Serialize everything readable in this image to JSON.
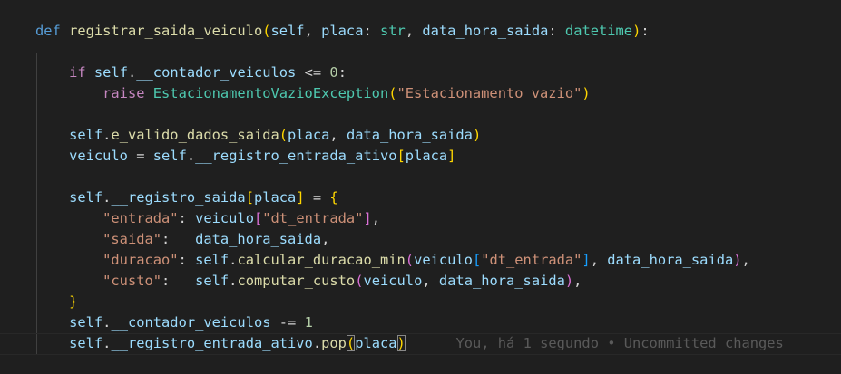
{
  "editor": {
    "language": "python",
    "colors": {
      "background": "#1f1f1f",
      "keyword_blue": "#569cd6",
      "keyword_purple": "#c586c0",
      "function": "#dcdcaa",
      "variable": "#9cdcfe",
      "type": "#4ec9b0",
      "string": "#ce9178",
      "number": "#b5cea8"
    },
    "blame_annotation": "You, há 1 segundo • Uncommitted changes",
    "lines": [
      [
        {
          "t": "def",
          "c": "kw"
        },
        {
          "t": " ",
          "c": "sp"
        },
        {
          "t": "registrar_saida_veiculo",
          "c": "fn"
        },
        {
          "t": "(",
          "c": "b1"
        },
        {
          "t": "self",
          "c": "pm"
        },
        {
          "t": ", ",
          "c": "op"
        },
        {
          "t": "placa",
          "c": "pm"
        },
        {
          "t": ": ",
          "c": "op"
        },
        {
          "t": "str",
          "c": "ty"
        },
        {
          "t": ", ",
          "c": "op"
        },
        {
          "t": "data_hora_saida",
          "c": "pm"
        },
        {
          "t": ": ",
          "c": "op"
        },
        {
          "t": "datetime",
          "c": "ty"
        },
        {
          "t": ")",
          "c": "b1"
        },
        {
          "t": ":",
          "c": "op"
        }
      ],
      [],
      [
        {
          "t": "    ",
          "c": "sp"
        },
        {
          "t": "if",
          "c": "kw2"
        },
        {
          "t": " ",
          "c": "sp"
        },
        {
          "t": "self",
          "c": "pm"
        },
        {
          "t": ".",
          "c": "op"
        },
        {
          "t": "__contador_veiculos",
          "c": "pm"
        },
        {
          "t": " <= ",
          "c": "op"
        },
        {
          "t": "0",
          "c": "nu"
        },
        {
          "t": ":",
          "c": "op"
        }
      ],
      [
        {
          "t": "        ",
          "c": "sp"
        },
        {
          "t": "raise",
          "c": "kw2"
        },
        {
          "t": " ",
          "c": "sp"
        },
        {
          "t": "EstacionamentoVazioException",
          "c": "ty"
        },
        {
          "t": "(",
          "c": "b1"
        },
        {
          "t": "\"Estacionamento vazio\"",
          "c": "st"
        },
        {
          "t": ")",
          "c": "b1"
        }
      ],
      [],
      [
        {
          "t": "    ",
          "c": "sp"
        },
        {
          "t": "self",
          "c": "pm"
        },
        {
          "t": ".",
          "c": "op"
        },
        {
          "t": "e_valido_dados_saida",
          "c": "fn"
        },
        {
          "t": "(",
          "c": "b1"
        },
        {
          "t": "placa",
          "c": "pm"
        },
        {
          "t": ", ",
          "c": "op"
        },
        {
          "t": "data_hora_saida",
          "c": "pm"
        },
        {
          "t": ")",
          "c": "b1"
        }
      ],
      [
        {
          "t": "    ",
          "c": "sp"
        },
        {
          "t": "veiculo",
          "c": "pm"
        },
        {
          "t": " = ",
          "c": "op"
        },
        {
          "t": "self",
          "c": "pm"
        },
        {
          "t": ".",
          "c": "op"
        },
        {
          "t": "__registro_entrada_ativo",
          "c": "pm"
        },
        {
          "t": "[",
          "c": "b1"
        },
        {
          "t": "placa",
          "c": "pm"
        },
        {
          "t": "]",
          "c": "b1"
        }
      ],
      [],
      [
        {
          "t": "    ",
          "c": "sp"
        },
        {
          "t": "self",
          "c": "pm"
        },
        {
          "t": ".",
          "c": "op"
        },
        {
          "t": "__registro_saida",
          "c": "pm"
        },
        {
          "t": "[",
          "c": "b1"
        },
        {
          "t": "placa",
          "c": "pm"
        },
        {
          "t": "]",
          "c": "b1"
        },
        {
          "t": " = ",
          "c": "op"
        },
        {
          "t": "{",
          "c": "b1"
        }
      ],
      [
        {
          "t": "        ",
          "c": "sp"
        },
        {
          "t": "\"entrada\"",
          "c": "st"
        },
        {
          "t": ": ",
          "c": "op"
        },
        {
          "t": "veiculo",
          "c": "pm"
        },
        {
          "t": "[",
          "c": "b2"
        },
        {
          "t": "\"dt_entrada\"",
          "c": "st"
        },
        {
          "t": "]",
          "c": "b2"
        },
        {
          "t": ",",
          "c": "op"
        }
      ],
      [
        {
          "t": "        ",
          "c": "sp"
        },
        {
          "t": "\"saida\"",
          "c": "st"
        },
        {
          "t": ":   ",
          "c": "op"
        },
        {
          "t": "data_hora_saida",
          "c": "pm"
        },
        {
          "t": ",",
          "c": "op"
        }
      ],
      [
        {
          "t": "        ",
          "c": "sp"
        },
        {
          "t": "\"duracao\"",
          "c": "st"
        },
        {
          "t": ": ",
          "c": "op"
        },
        {
          "t": "self",
          "c": "pm"
        },
        {
          "t": ".",
          "c": "op"
        },
        {
          "t": "calcular_duracao_min",
          "c": "fn"
        },
        {
          "t": "(",
          "c": "b2"
        },
        {
          "t": "veiculo",
          "c": "pm"
        },
        {
          "t": "[",
          "c": "b3"
        },
        {
          "t": "\"dt_entrada\"",
          "c": "st"
        },
        {
          "t": "]",
          "c": "b3"
        },
        {
          "t": ", ",
          "c": "op"
        },
        {
          "t": "data_hora_saida",
          "c": "pm"
        },
        {
          "t": ")",
          "c": "b2"
        },
        {
          "t": ",",
          "c": "op"
        }
      ],
      [
        {
          "t": "        ",
          "c": "sp"
        },
        {
          "t": "\"custo\"",
          "c": "st"
        },
        {
          "t": ":   ",
          "c": "op"
        },
        {
          "t": "self",
          "c": "pm"
        },
        {
          "t": ".",
          "c": "op"
        },
        {
          "t": "computar_custo",
          "c": "fn"
        },
        {
          "t": "(",
          "c": "b2"
        },
        {
          "t": "veiculo",
          "c": "pm"
        },
        {
          "t": ", ",
          "c": "op"
        },
        {
          "t": "data_hora_saida",
          "c": "pm"
        },
        {
          "t": ")",
          "c": "b2"
        },
        {
          "t": ",",
          "c": "op"
        }
      ],
      [
        {
          "t": "    ",
          "c": "sp"
        },
        {
          "t": "}",
          "c": "b1"
        }
      ],
      [
        {
          "t": "    ",
          "c": "sp"
        },
        {
          "t": "self",
          "c": "pm"
        },
        {
          "t": ".",
          "c": "op"
        },
        {
          "t": "__contador_veiculos",
          "c": "pm"
        },
        {
          "t": " -= ",
          "c": "op"
        },
        {
          "t": "1",
          "c": "nu"
        }
      ],
      [
        {
          "t": "    ",
          "c": "sp"
        },
        {
          "t": "self",
          "c": "pm"
        },
        {
          "t": ".",
          "c": "op"
        },
        {
          "t": "__registro_entrada_ativo",
          "c": "pm"
        },
        {
          "t": ".",
          "c": "op"
        },
        {
          "t": "pop",
          "c": "fn"
        },
        {
          "t": "(",
          "c": "b1 pm-box"
        },
        {
          "t": "placa",
          "c": "pm"
        },
        {
          "t": ")",
          "c": "b1 pm-box"
        }
      ]
    ]
  }
}
